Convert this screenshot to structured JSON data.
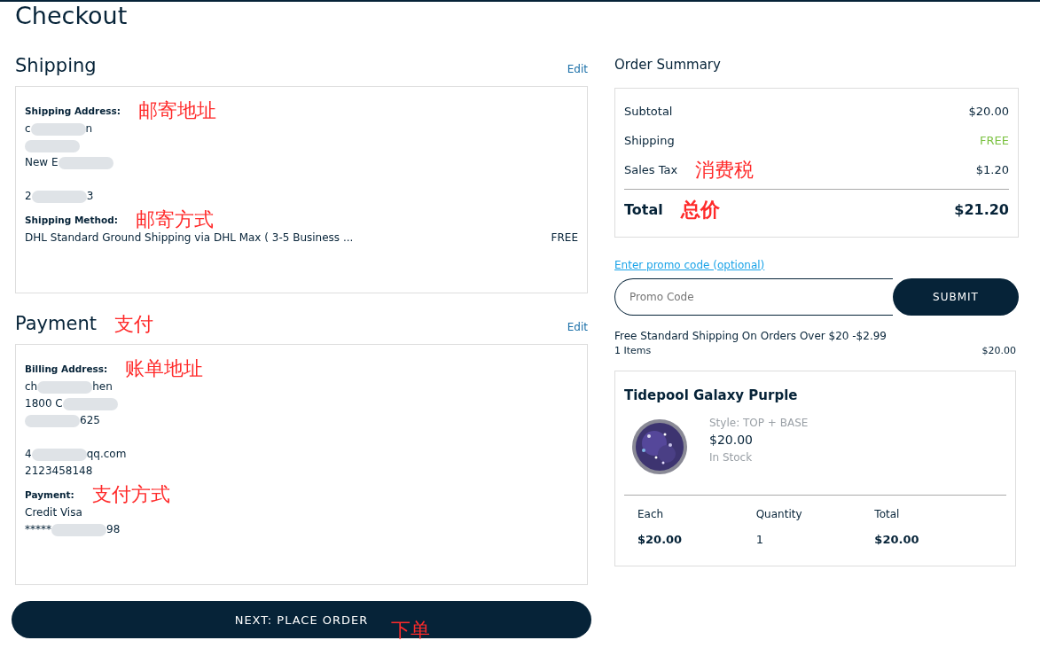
{
  "title": "Checkout",
  "shipping": {
    "heading": "Shipping",
    "edit": "Edit",
    "address_label": "Shipping Address:",
    "address_note": "邮寄地址",
    "address_lines": [
      [
        {
          "kind": "text",
          "text": "c"
        },
        {
          "kind": "redaction"
        },
        {
          "kind": "text",
          "text": "n"
        }
      ],
      [
        {
          "kind": "redaction"
        }
      ],
      [
        {
          "kind": "text",
          "text": "New E"
        },
        {
          "kind": "redaction"
        }
      ],
      [
        {
          "kind": "gap"
        }
      ],
      [
        {
          "kind": "text",
          "text": "2"
        },
        {
          "kind": "redaction"
        },
        {
          "kind": "text",
          "text": "3"
        }
      ]
    ],
    "method_label": "Shipping Method:",
    "method_note": "邮寄方式",
    "method": "DHL Standard Ground Shipping via DHL Max ( 3-5 Business ...",
    "method_price": "FREE"
  },
  "payment": {
    "heading": "Payment",
    "heading_note": "支付",
    "edit": "Edit",
    "address_label": "Billing Address:",
    "address_note": "账单地址",
    "address_lines": [
      [
        {
          "kind": "text",
          "text": "ch"
        },
        {
          "kind": "redaction"
        },
        {
          "kind": "text",
          "text": "hen"
        }
      ],
      [
        {
          "kind": "text",
          "text": "1800 C"
        },
        {
          "kind": "redaction"
        }
      ],
      [
        {
          "kind": "redaction"
        },
        {
          "kind": "text",
          "text": "625"
        }
      ],
      [
        {
          "kind": "gap"
        }
      ],
      [
        {
          "kind": "text",
          "text": "4"
        },
        {
          "kind": "redaction"
        },
        {
          "kind": "text",
          "text": "qq.com"
        }
      ],
      [
        {
          "kind": "text",
          "text": "2123458148"
        }
      ]
    ],
    "method_label": "Payment:",
    "method_note": "支付方式",
    "method_lines": [
      [
        {
          "kind": "text",
          "text": "Credit Visa"
        }
      ],
      [
        {
          "kind": "text",
          "text": "*****"
        },
        {
          "kind": "redaction"
        },
        {
          "kind": "text",
          "text": "98"
        }
      ]
    ]
  },
  "place_order": {
    "label": "NEXT: PLACE ORDER",
    "note": "下单"
  },
  "summary": {
    "heading": "Order Summary",
    "rows": [
      {
        "label": "Subtotal",
        "value": "$20.00",
        "highlight": false
      },
      {
        "label": "Shipping",
        "value": "FREE",
        "highlight": true
      },
      {
        "label": "Sales Tax",
        "value": "$1.20",
        "highlight": false,
        "note": "消费税"
      }
    ],
    "total_label": "Total",
    "total_note": "总价",
    "total_value": "$21.20"
  },
  "promo": {
    "link": "Enter promo code (optional)",
    "placeholder": "Promo Code",
    "button": "SUBMIT"
  },
  "shipping_offer": "Free Standard Shipping On Orders Over $20 -$2.99",
  "items_count": "1 Items",
  "items_total": "$20.00",
  "product": {
    "name": "Tidepool Galaxy Purple",
    "style": "Style: TOP + BASE",
    "price": "$20.00",
    "stock": "In Stock",
    "columns": [
      {
        "label": "Each",
        "value": "$20.00",
        "bold": true
      },
      {
        "label": "Quantity",
        "value": "1",
        "bold": false
      },
      {
        "label": "Total",
        "value": "$20.00",
        "bold": true
      }
    ]
  }
}
